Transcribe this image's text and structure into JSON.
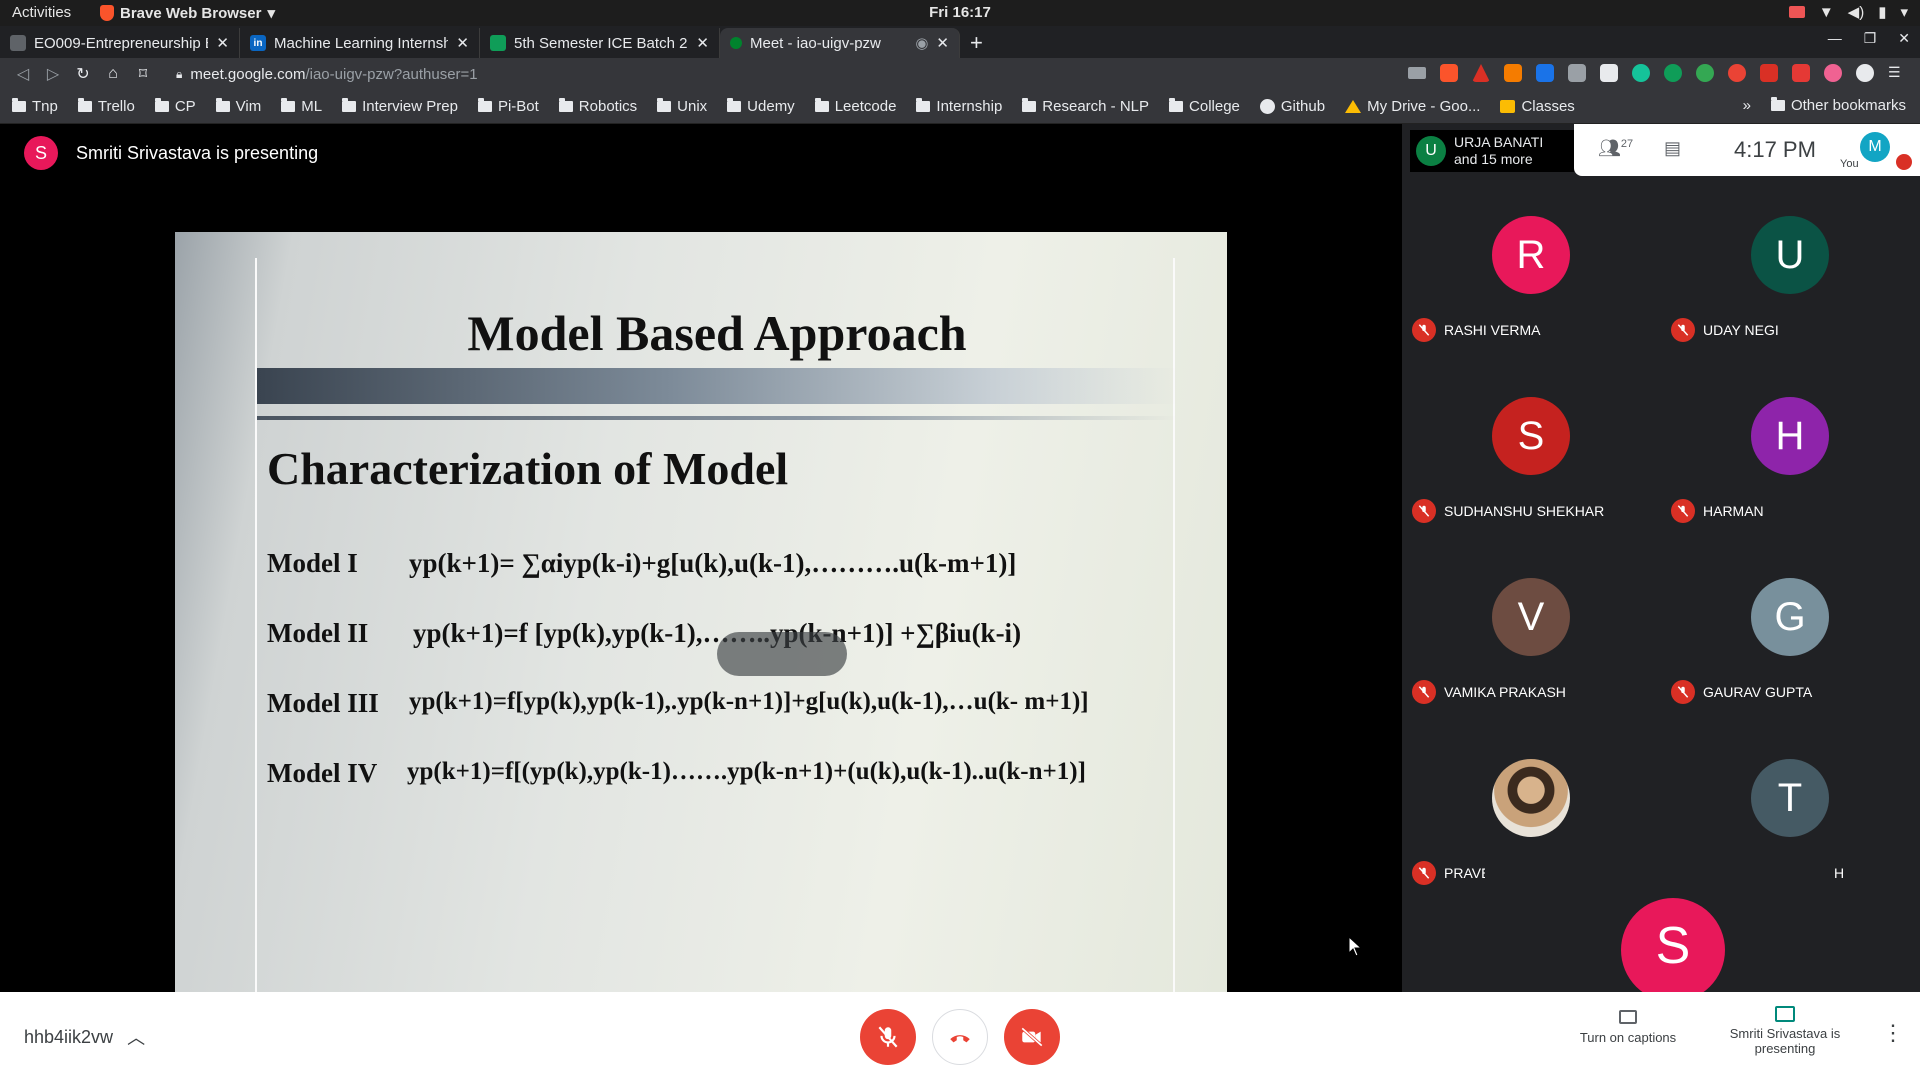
{
  "os_bar": {
    "activities": "Activities",
    "app_name": "Brave Web Browser",
    "clock": "Fri 16:17"
  },
  "tabs": [
    {
      "title": "EO009-Entrepreneurship B",
      "favicon_color": "#5f6368"
    },
    {
      "title": "Machine Learning Internsh",
      "favicon_color": "#0a66c2"
    },
    {
      "title": "5th Semester ICE Batch 2",
      "favicon_color": "#0f9d58"
    },
    {
      "title": "Meet - iao-uigv-pzw",
      "favicon_color": "#00832d"
    }
  ],
  "address": {
    "host": "meet.google.com",
    "path": "/iao-uigv-pzw?authuser=1"
  },
  "bookmarks": [
    "Tnp",
    "Trello",
    "CP",
    "Vim",
    "ML",
    "Interview Prep",
    "Pi-Bot",
    "Robotics",
    "Unix",
    "Udemy",
    "Leetcode",
    "Internship",
    "Research - NLP",
    "College",
    "Github",
    "My Drive - Goo...",
    "Classes"
  ],
  "bookmarks_overflow": "»",
  "other_bookmarks": "Other bookmarks",
  "presenter": {
    "initial": "S",
    "text": "Smriti Srivastava is presenting"
  },
  "slide": {
    "title": "Model Based Approach",
    "subtitle": "Characterization of Model",
    "models": [
      {
        "label": "Model I",
        "equation": "yp(k+1)= ∑αiyp(k-i)+g[u(k),u(k-1),……….u(k-m+1)]"
      },
      {
        "label": "Model II",
        "equation": "yp(k+1)=f [yp(k),yp(k-1),……..yp(k-n+1)]  +∑βiu(k-i)"
      },
      {
        "label": "Model III",
        "equation": "yp(k+1)=f[yp(k),yp(k-1),.yp(k-n+1)]+g[u(k),u(k-1),…u(k-  m+1)]"
      },
      {
        "label": "Model IV",
        "equation": "yp(k+1)=f[(yp(k),yp(k-1)…….yp(k-n+1)+(u(k),u(k-1)..u(k-n+1)]"
      }
    ]
  },
  "panel": {
    "owner_initial": "U",
    "owner_name": "URJA BANATI",
    "owner_more": "and 15 more",
    "people_count": "27",
    "time": "4:17 PM",
    "you_initial": "M",
    "you_label": "You"
  },
  "participants": [
    {
      "initial": "R",
      "name": "RASHI VERMA",
      "color": "#e8185a"
    },
    {
      "initial": "U",
      "name": "UDAY NEGI",
      "color": "#0b5345"
    },
    {
      "initial": "S",
      "name": "SUDHANSHU SHEKHAR",
      "color": "#c5221f"
    },
    {
      "initial": "H",
      "name": "HARMAN",
      "color": "#8e24aa"
    },
    {
      "initial": "V",
      "name": "VAMIKA PRAKASH",
      "color": "#6d4c41"
    },
    {
      "initial": "G",
      "name": "GAURAV GUPTA",
      "color": "#78909c"
    },
    {
      "initial": "",
      "name": "PRAVEEN KUMAR",
      "color": "#b08968"
    },
    {
      "initial": "T",
      "name": "TARANPREET SINGH",
      "color": "#455a64"
    }
  ],
  "last_tile_initial": "S",
  "bottom": {
    "meeting_code": "hhb4iik2vw",
    "captions_label": "Turn on captions",
    "presenting_label": "Smriti Srivastava is presenting"
  }
}
